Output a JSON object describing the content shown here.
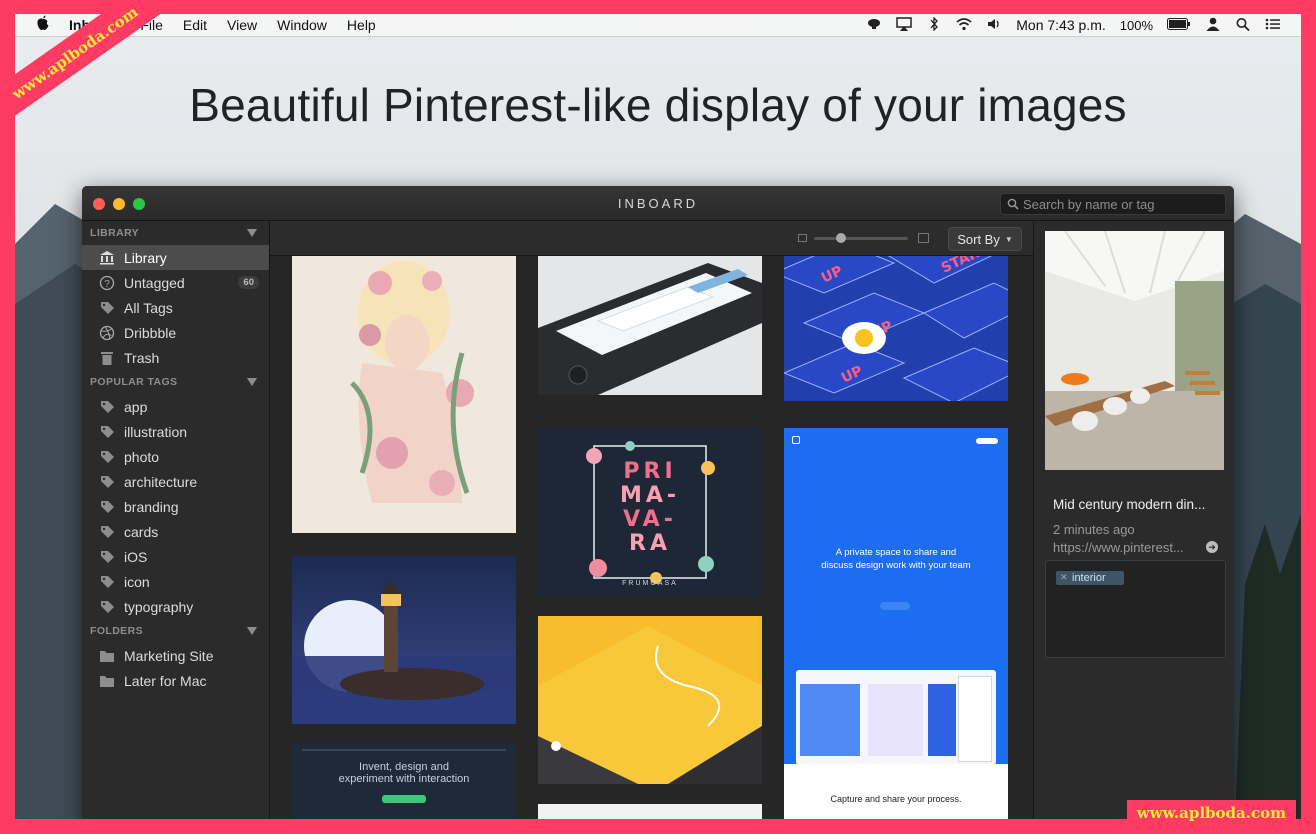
{
  "menubar": {
    "app_name": "Inboard",
    "items": [
      "File",
      "Edit",
      "View",
      "Window",
      "Help"
    ],
    "clock": "Mon 7:43 p.m.",
    "battery": "100%"
  },
  "watermark": {
    "text": "www.aplboda.com"
  },
  "headline": "Beautiful Pinterest-like display of your images",
  "window": {
    "title": "INBOARD",
    "search_placeholder": "Search by name or tag",
    "sort_label": "Sort By"
  },
  "sidebar": {
    "library_header": "LIBRARY",
    "library_items": [
      {
        "label": "Library",
        "icon": "library-icon",
        "active": true
      },
      {
        "label": "Untagged",
        "icon": "question-icon",
        "badge": "60"
      },
      {
        "label": "All Tags",
        "icon": "tag-icon"
      },
      {
        "label": "Dribbble",
        "icon": "dribbble-icon"
      },
      {
        "label": "Trash",
        "icon": "trash-icon"
      }
    ],
    "tags_header": "POPULAR TAGS",
    "tags": [
      "app",
      "illustration",
      "photo",
      "architecture",
      "branding",
      "cards",
      "iOS",
      "icon",
      "typography"
    ],
    "folders_header": "FOLDERS",
    "folders": [
      "Marketing Site",
      "Later for Mac"
    ]
  },
  "grid": {
    "card_texts": {
      "primavara": [
        "PRI",
        "MA-",
        "VA-",
        "RA"
      ],
      "primavara_sub": "FRUMOASA",
      "blue_hero": "A private space to share and discuss design work with your team",
      "blue_bottom": "Capture and share your process.",
      "dark_web": "Invent, design and experiment with interaction"
    }
  },
  "inspector": {
    "title": "Mid century modern din...",
    "time": "2 minutes ago",
    "url": "https://www.pinterest...",
    "tags": [
      "interior"
    ]
  }
}
